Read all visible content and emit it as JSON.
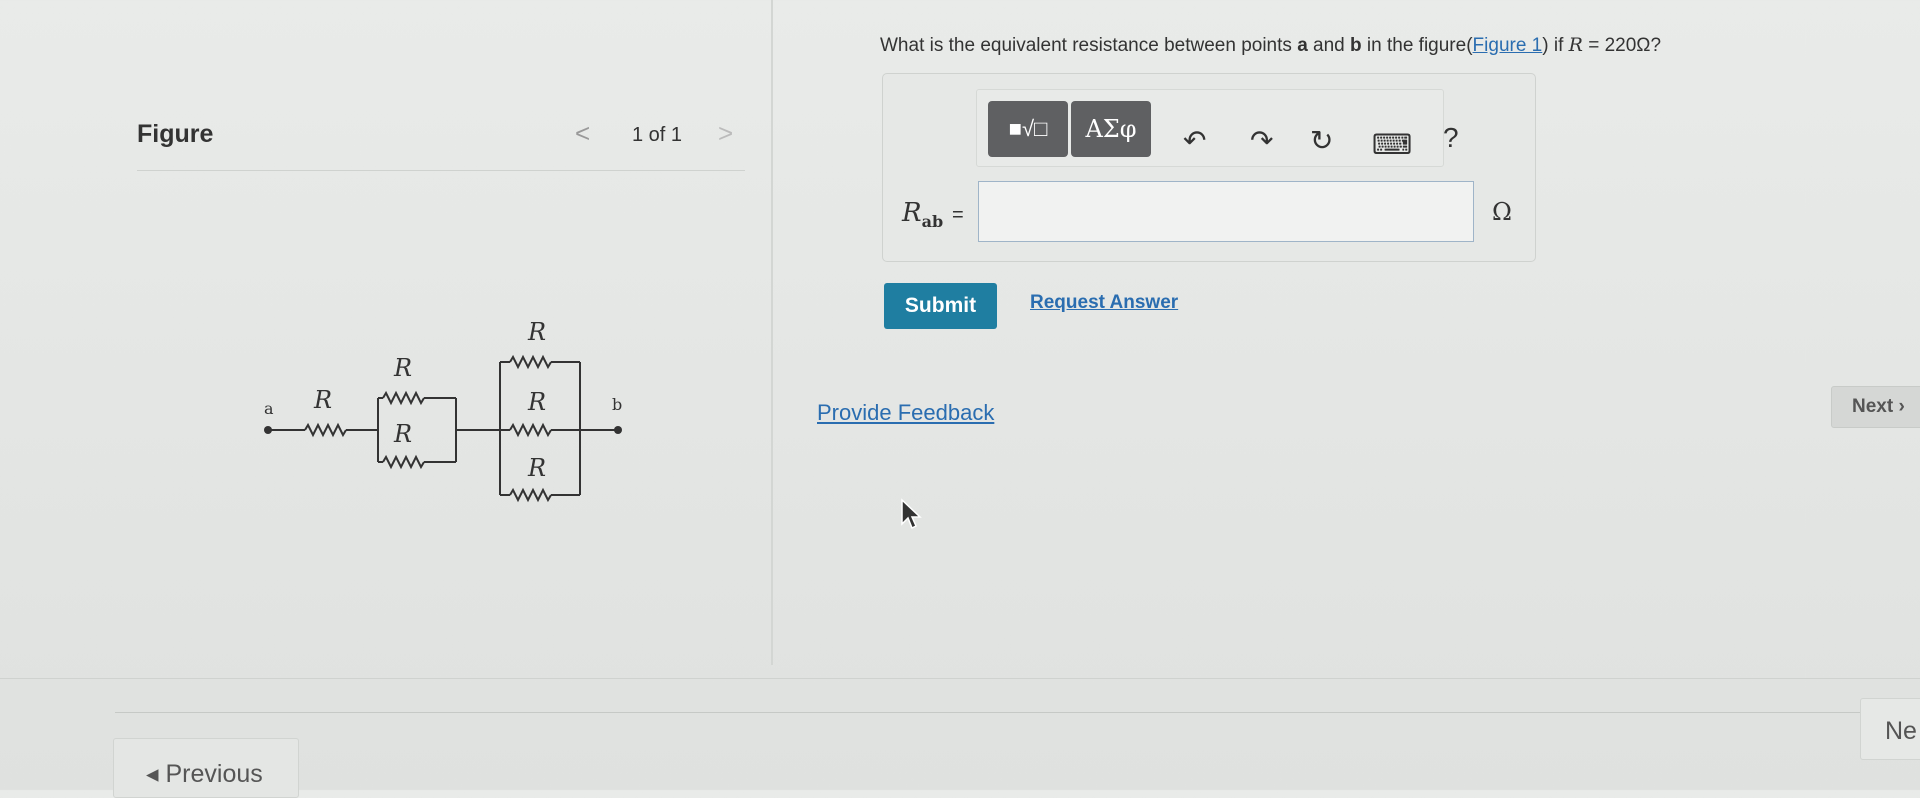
{
  "figure_panel": {
    "title": "Figure",
    "prev_glyph": "<",
    "counter": "1 of 1",
    "next_glyph": ">"
  },
  "circuit": {
    "resistor_label": "R",
    "node_a": "a",
    "node_b": "b"
  },
  "question": {
    "text_before": "What is the equivalent resistance between points ",
    "point_a": "a",
    "text_and": " and ",
    "point_b": "b",
    "text_mid": " in the figure(",
    "figure_link": "Figure 1",
    "text_if": ") if ",
    "math_R": "R",
    "math_eq": " = 220Ω?"
  },
  "toolbar": {
    "templates_label": "■√□",
    "symbols_label": "ΑΣφ",
    "undo_glyph": "↶",
    "redo_glyph": "↷",
    "reset_glyph": "↻",
    "keyboard_glyph": "⌨",
    "help_glyph": "?"
  },
  "answer": {
    "label_main": "R",
    "label_sub": "ab",
    "equals": "=",
    "value": "",
    "unit": "Ω"
  },
  "actions": {
    "submit": "Submit",
    "request_answer": "Request Answer",
    "provide_feedback": "Provide Feedback"
  },
  "navigation": {
    "next": "Next ›",
    "previous": "◂ Previous",
    "next_bottom": "Ne"
  }
}
